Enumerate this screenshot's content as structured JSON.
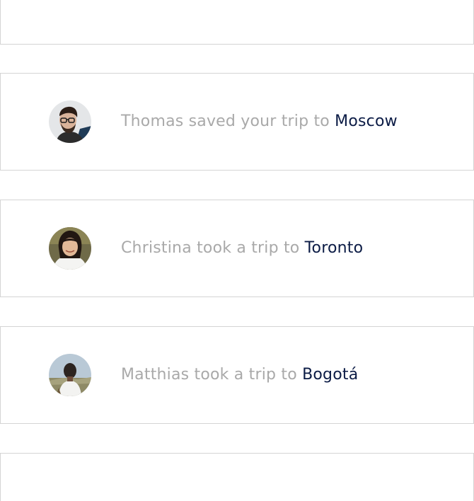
{
  "feed": {
    "items": [
      {
        "avatar_icon": "person-avatar-icon",
        "actor_text": "Thomas saved your trip to ",
        "place": "Moscow"
      },
      {
        "avatar_icon": "person-avatar-icon",
        "actor_text": "Christina took a trip to ",
        "place": "Toronto"
      },
      {
        "avatar_icon": "person-avatar-icon",
        "actor_text": "Matthias took a trip to ",
        "place": "Bogotá"
      }
    ]
  },
  "colors": {
    "text_muted": "#a9a9a9",
    "place_text": "#0b1b45",
    "card_border": "#d4d4d4"
  }
}
